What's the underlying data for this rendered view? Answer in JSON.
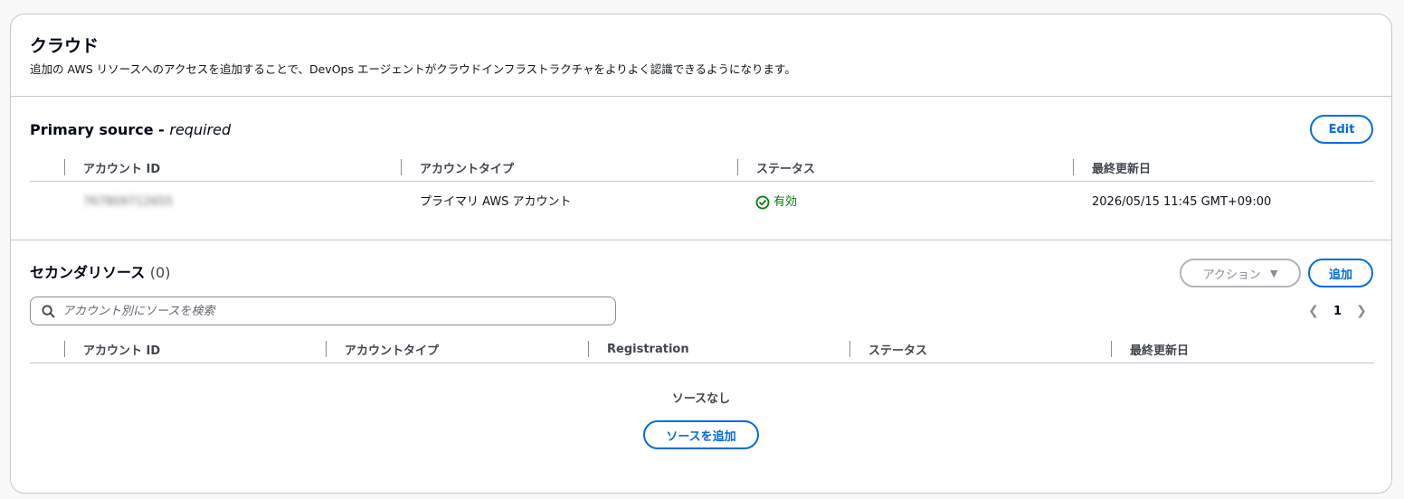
{
  "header": {
    "title": "クラウド",
    "description": "追加の AWS リソースへのアクセスを追加することで、DevOps エージェントがクラウドインフラストラクチャをよりよく認識できるようになります。"
  },
  "primary": {
    "title": "Primary source - ",
    "title_suffix": "required",
    "edit_label": "Edit",
    "columns": [
      "アカウント ID",
      "アカウントタイプ",
      "ステータス",
      "最終更新日"
    ],
    "row": {
      "account_id": "767809712655",
      "account_type": "プライマリ AWS アカウント",
      "status": "有効",
      "updated": "2026/05/15 11:45 GMT+09:00"
    },
    "status_color": "#037f0c"
  },
  "secondary": {
    "title": "セカンダリソース",
    "count": "(0)",
    "actions_label": "アクション",
    "add_label": "追加",
    "search_placeholder": "アカウント別にソースを検索",
    "page": "1",
    "columns": [
      "アカウント ID",
      "アカウントタイプ",
      "Registration",
      "ステータス",
      "最終更新日"
    ],
    "empty_text": "ソースなし",
    "add_source_label": "ソースを追加"
  },
  "colors": {
    "accent": "#006ce0",
    "border": "#c6c6cd",
    "success": "#037f0c"
  }
}
